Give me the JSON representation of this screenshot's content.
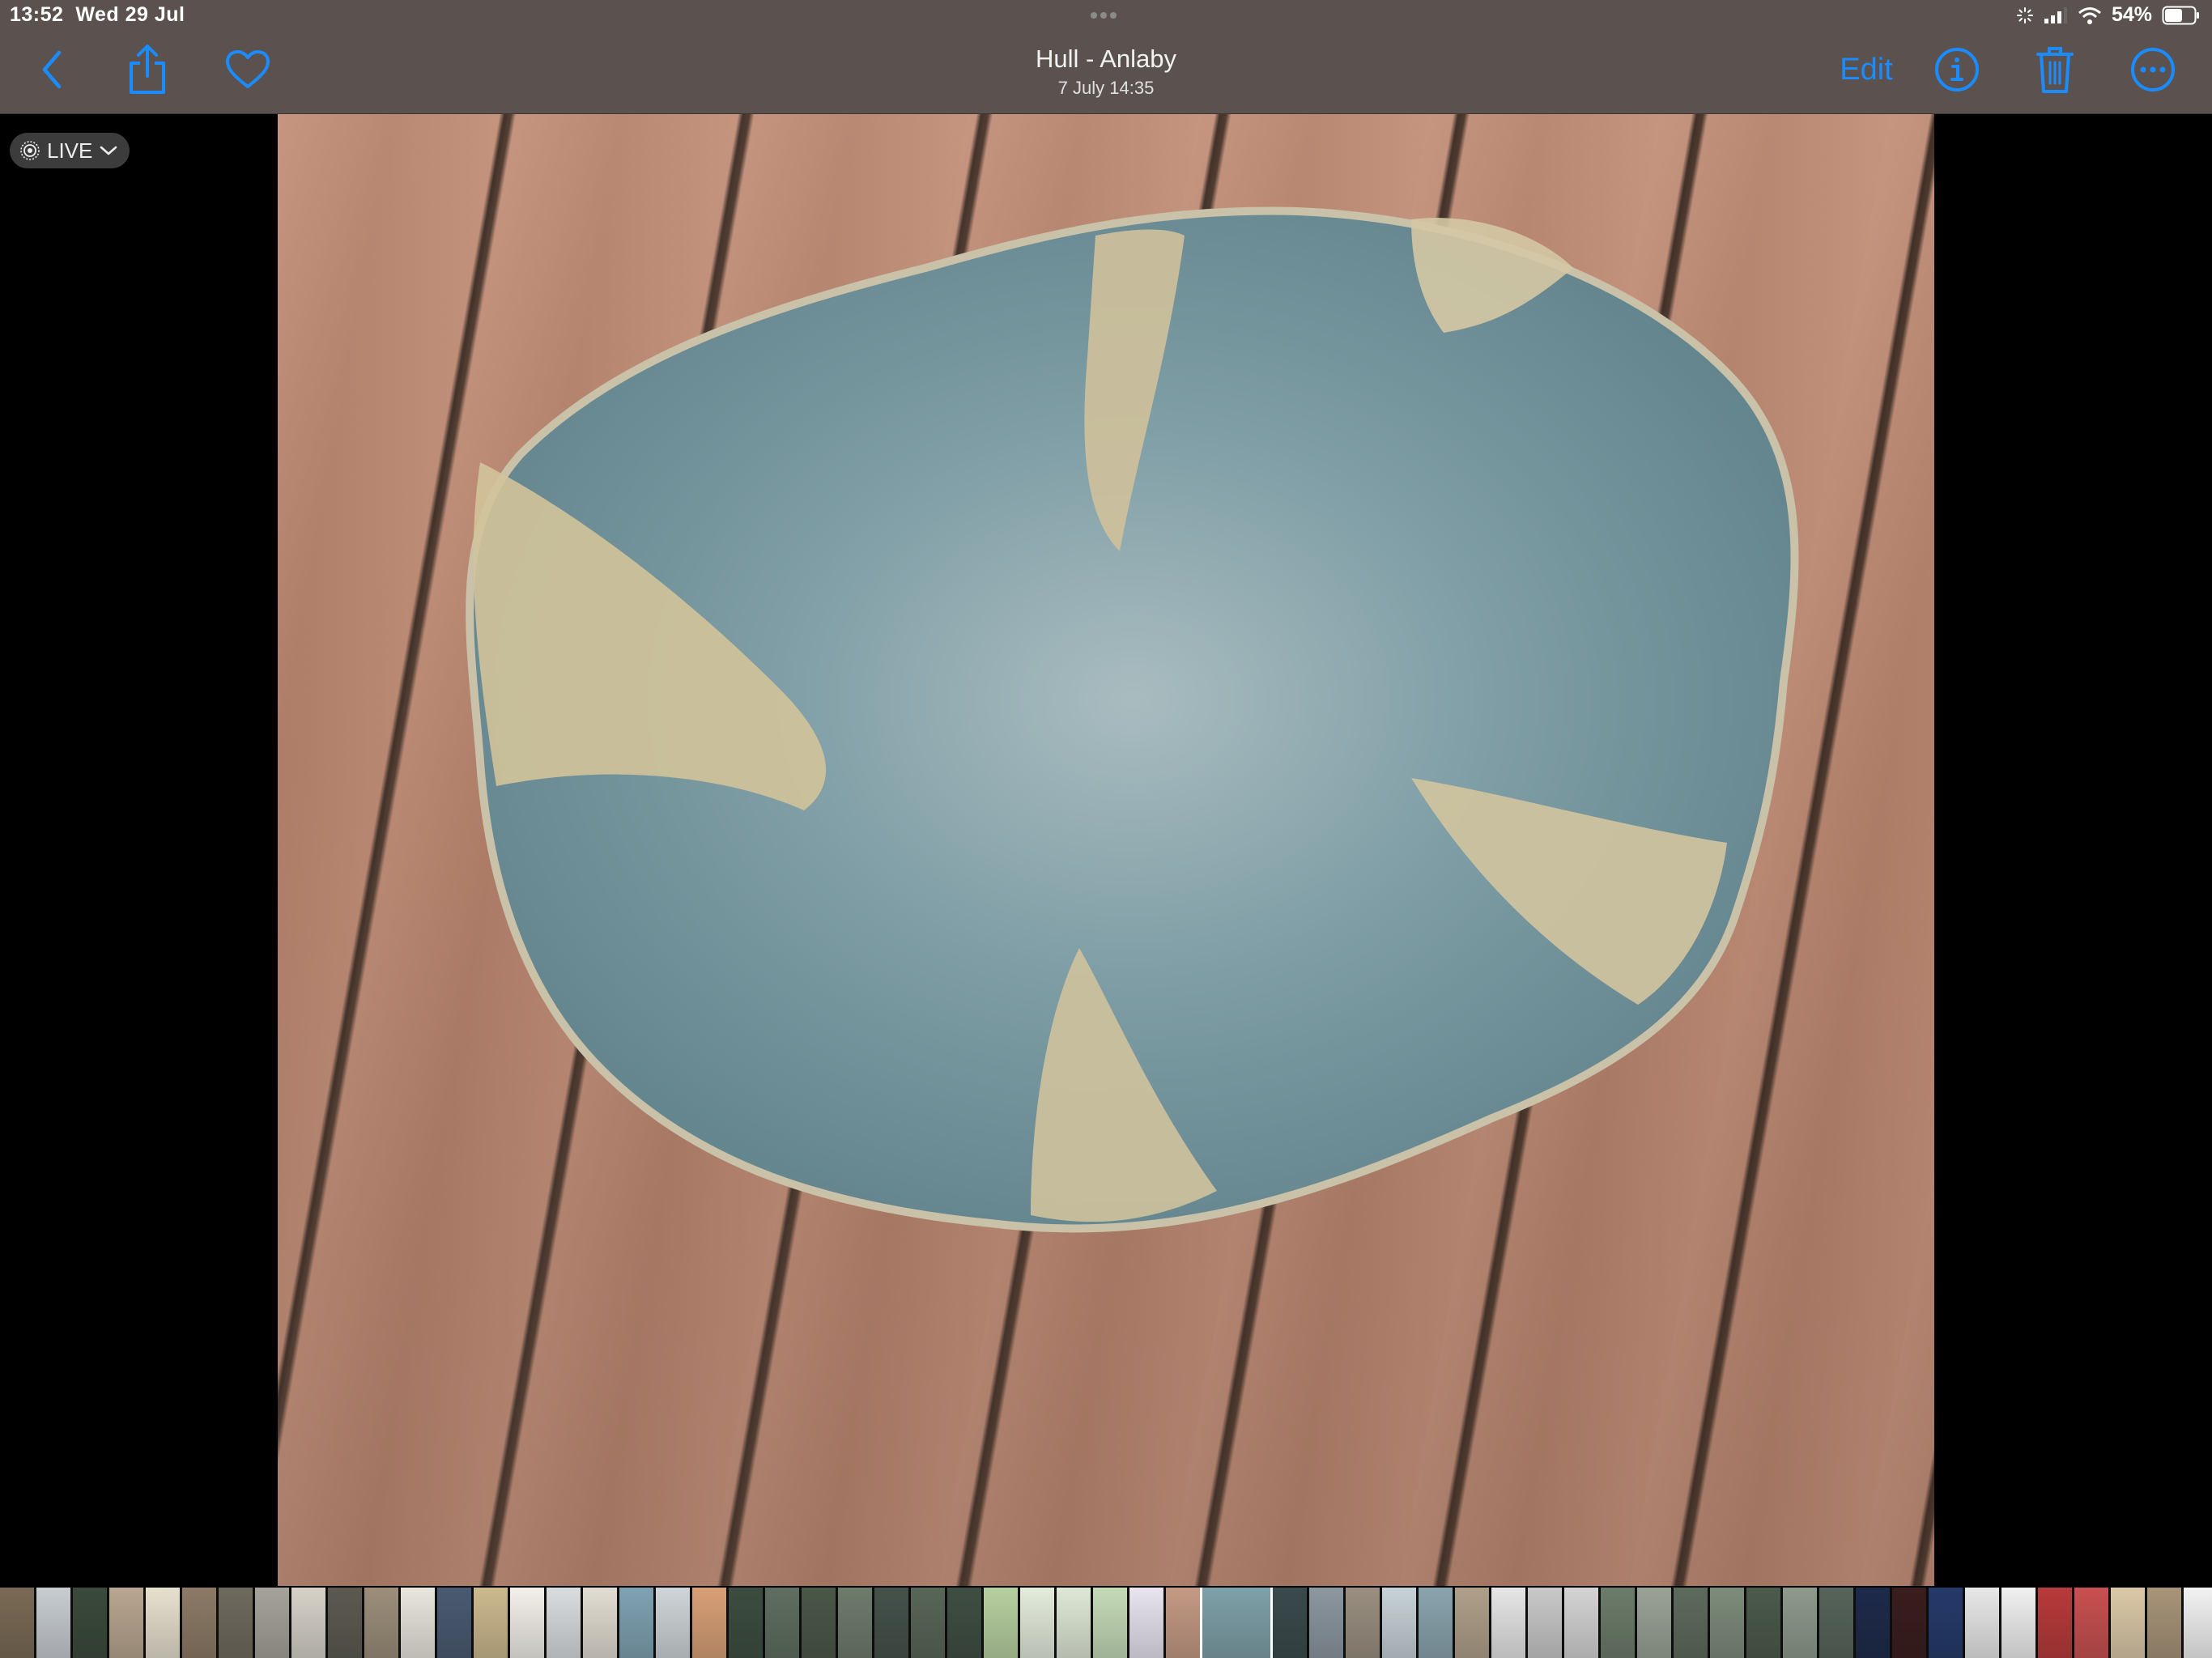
{
  "status_bar": {
    "time": "13:52",
    "date": "Wed 29 Jul",
    "battery": "54%",
    "icons": [
      "activity-icon",
      "signal-icon",
      "wifi-icon",
      "battery-icon"
    ]
  },
  "nav": {
    "title": "Hull - Anlaby",
    "subtitle": "7 July  14:35",
    "edit_label": "Edit",
    "icons": {
      "back": "chevron-left-icon",
      "share": "share-icon",
      "favorite": "heart-icon",
      "info": "info-icon",
      "delete": "trash-icon",
      "more": "ellipsis-circle-icon"
    }
  },
  "live_badge": {
    "label": "LIVE",
    "icons": [
      "live-photo-icon",
      "chevron-down-icon"
    ]
  },
  "accent_color": "#1a8cff",
  "filmstrip": {
    "thumbnails": [
      "#7a6a55",
      "#c8cdd2",
      "#3a4a3a",
      "#b9a690",
      "#e8e0cf",
      "#8c7a66",
      "#6f6a5e",
      "#a6a39a",
      "#d6d2c8",
      "#5c5a50",
      "#9c8e7a",
      "#e9e6dd",
      "#4a5a72",
      "#ccb98e",
      "#f3f0ea",
      "#d9dde0",
      "#e2ddd2",
      "#7fa2b2",
      "#cfd5d8",
      "#d8a076",
      "#3c4d40",
      "#5f6e60",
      "#4a5848",
      "#6e7c6c",
      "#44524a",
      "#586657",
      "#3f4e43",
      "#b7d0a0",
      "#e4ecdc",
      "#dfe8d6",
      "#c5dbb8",
      "#e8e4f0",
      "#c49a84",
      "#7ea0a8",
      "#3a4a4c",
      "#8c97a0",
      "#9a8f80",
      "#c7d2d8",
      "#8aa4ae",
      "#b0a08a",
      "#e6e6e6",
      "#c9c9c9",
      "#d4d4d4",
      "#6c7c6a",
      "#9aa396",
      "#5d6b5c",
      "#7d8c7b",
      "#4b5a4a",
      "#8e9a8c",
      "#56645a",
      "#1d2a4a",
      "#3a1d1d",
      "#243a6a",
      "#e8e8e8",
      "#f0f0f0",
      "#b83a3a",
      "#c95050",
      "#dcc9a8",
      "#a89478",
      "#f2f2f2",
      "#4a7ac0",
      "#d8e2ee",
      "#5a8fd0",
      "#7a8a90",
      "#a9b3b8",
      "#e9e9e9",
      "#d2d6da",
      "#6f6f6f",
      "#8a8a8a",
      "#b4b4b4"
    ],
    "selected_index": 33
  }
}
